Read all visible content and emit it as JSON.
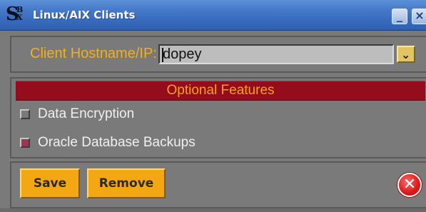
{
  "window": {
    "title": "Linux/AIX Clients",
    "logo": {
      "main": "S",
      "top": "B",
      "bottom": "X"
    },
    "minimize_glyph": "_",
    "close_glyph": "×"
  },
  "host": {
    "label": "Client Hostname/IP:",
    "value": "dopey",
    "dropdown_icon": "chevron-down-icon",
    "dropdown_glyph": "⌄"
  },
  "features": {
    "header": "Optional Features",
    "options": [
      {
        "label": "Data Encryption",
        "checked": false
      },
      {
        "label": "Oracle Database Backups",
        "checked": true
      }
    ]
  },
  "actions": {
    "save_label": "Save",
    "remove_label": "Remove",
    "close_glyph": "✕"
  },
  "colors": {
    "titlebar": "#3f73c4",
    "panel": "#7a7a7a",
    "accent_orange": "#f2a713",
    "label_orange": "#f2b01c",
    "header_red": "#950d1c",
    "close_red": "#e01d1d"
  }
}
